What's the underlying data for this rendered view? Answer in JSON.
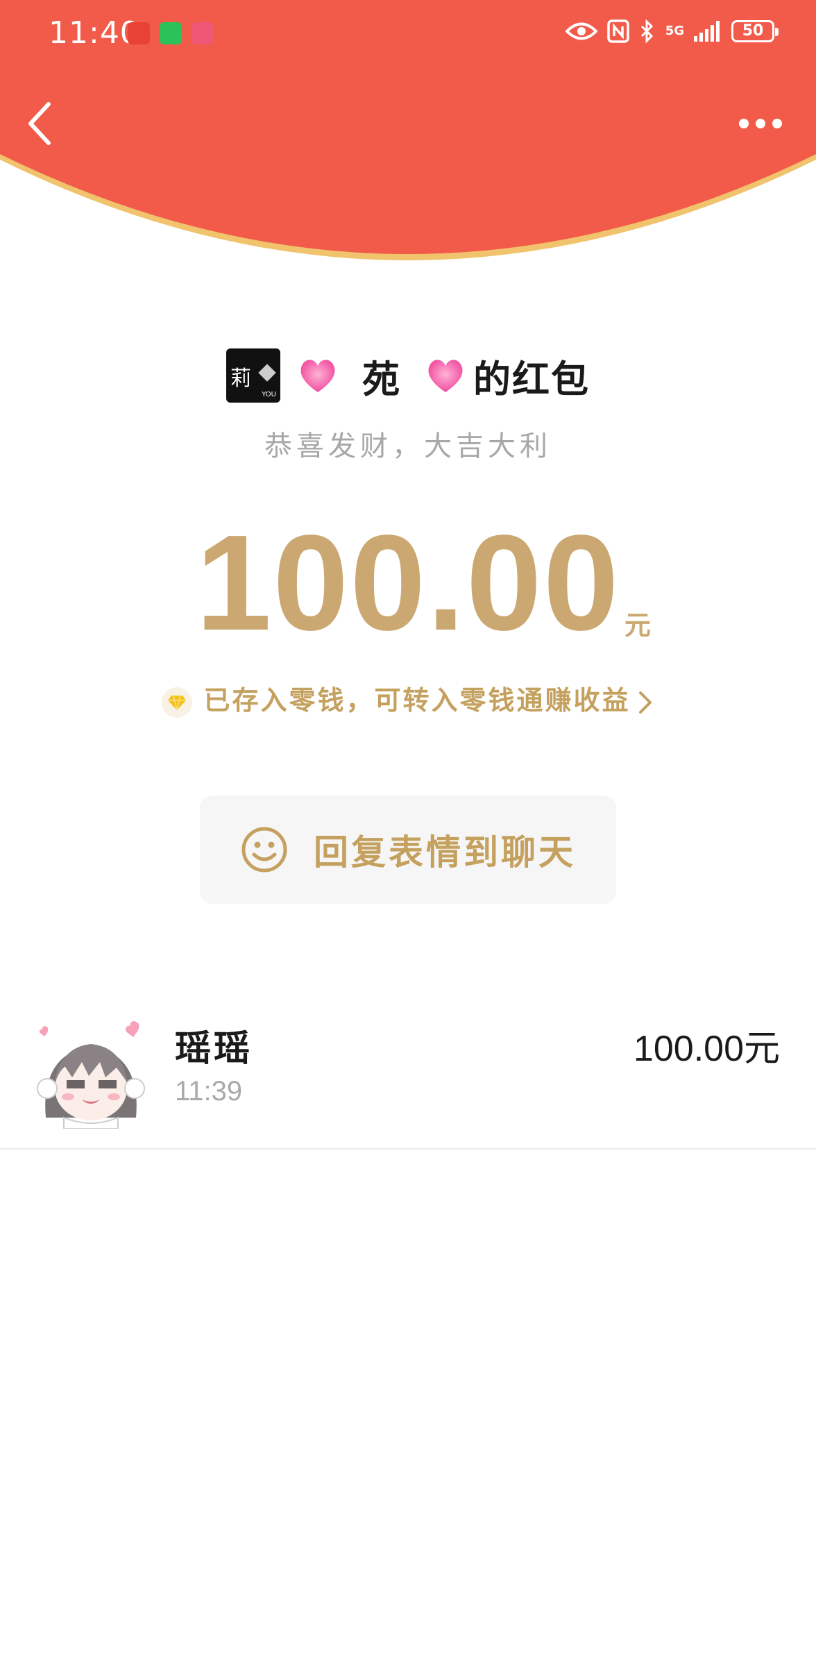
{
  "status_bar": {
    "time": "11:40",
    "network": "5G",
    "battery": "50"
  },
  "header": {
    "back_icon": "chevron-left-icon",
    "more_icon": "more-dots-icon",
    "bg_color": "#f25a4a",
    "rim_color": "#f0c36c"
  },
  "sender": {
    "name_part1": "苑",
    "title_suffix": "的红包",
    "avatar_text": "莉",
    "avatar_sub": "YOU"
  },
  "greeting": "恭喜发财，大吉大利",
  "amount": {
    "value": "100.00",
    "unit": "元",
    "color": "#cba871"
  },
  "saved_notice": "已存入零钱，可转入零钱通赚收益",
  "reply_button": {
    "label": "回复表情到聊天",
    "icon": "smiley-icon"
  },
  "records": [
    {
      "name": "瑶瑶",
      "time": "11:39",
      "amount": "100.00元"
    }
  ]
}
